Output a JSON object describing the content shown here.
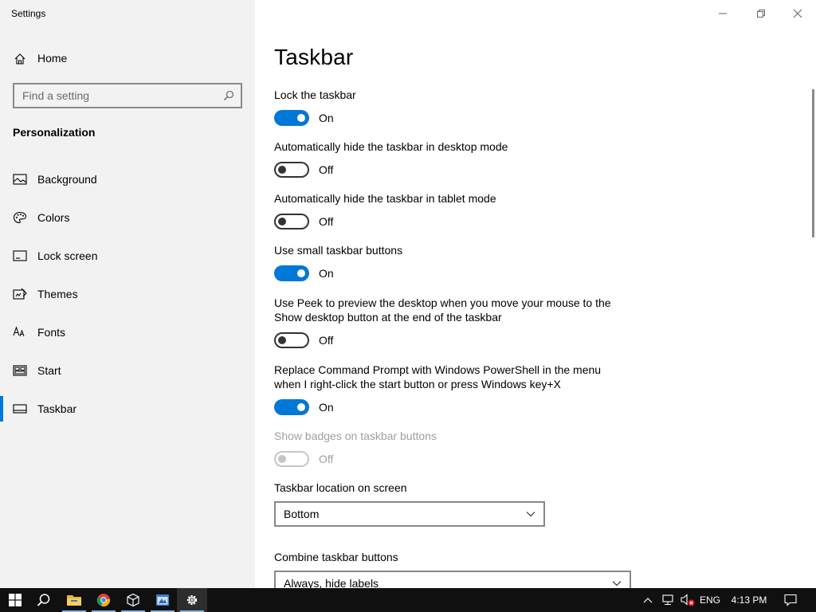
{
  "window": {
    "title": "Settings"
  },
  "sidebar": {
    "home_label": "Home",
    "search_placeholder": "Find a setting",
    "section_title": "Personalization",
    "items": [
      {
        "label": "Background",
        "icon": "image-icon"
      },
      {
        "label": "Colors",
        "icon": "palette-icon"
      },
      {
        "label": "Lock screen",
        "icon": "lock-screen-icon"
      },
      {
        "label": "Themes",
        "icon": "themes-icon"
      },
      {
        "label": "Fonts",
        "icon": "fonts-icon"
      },
      {
        "label": "Start",
        "icon": "start-icon"
      },
      {
        "label": "Taskbar",
        "icon": "taskbar-icon",
        "active": true
      }
    ]
  },
  "main": {
    "title": "Taskbar",
    "settings": [
      {
        "label": "Lock the taskbar",
        "state": "On"
      },
      {
        "label": "Automatically hide the taskbar in desktop mode",
        "state": "Off"
      },
      {
        "label": "Automatically hide the taskbar in tablet mode",
        "state": "Off"
      },
      {
        "label": "Use small taskbar buttons",
        "state": "On"
      },
      {
        "label": "Use Peek to preview the desktop when you move your mouse to the Show desktop button at the end of the taskbar",
        "state": "Off"
      },
      {
        "label": "Replace Command Prompt with Windows PowerShell in the menu when I right-click the start button or press Windows key+X",
        "state": "On"
      },
      {
        "label": "Show badges on taskbar buttons",
        "state": "Off",
        "disabled": true
      }
    ],
    "location": {
      "label": "Taskbar location on screen",
      "value": "Bottom"
    },
    "combine": {
      "label": "Combine taskbar buttons",
      "value": "Always, hide labels"
    }
  },
  "taskbar": {
    "language": "ENG",
    "time": "4:13 PM"
  },
  "colors": {
    "accent": "#0078d7",
    "sidebar_bg": "#f2f2f2",
    "taskbar_bg": "#101010"
  }
}
